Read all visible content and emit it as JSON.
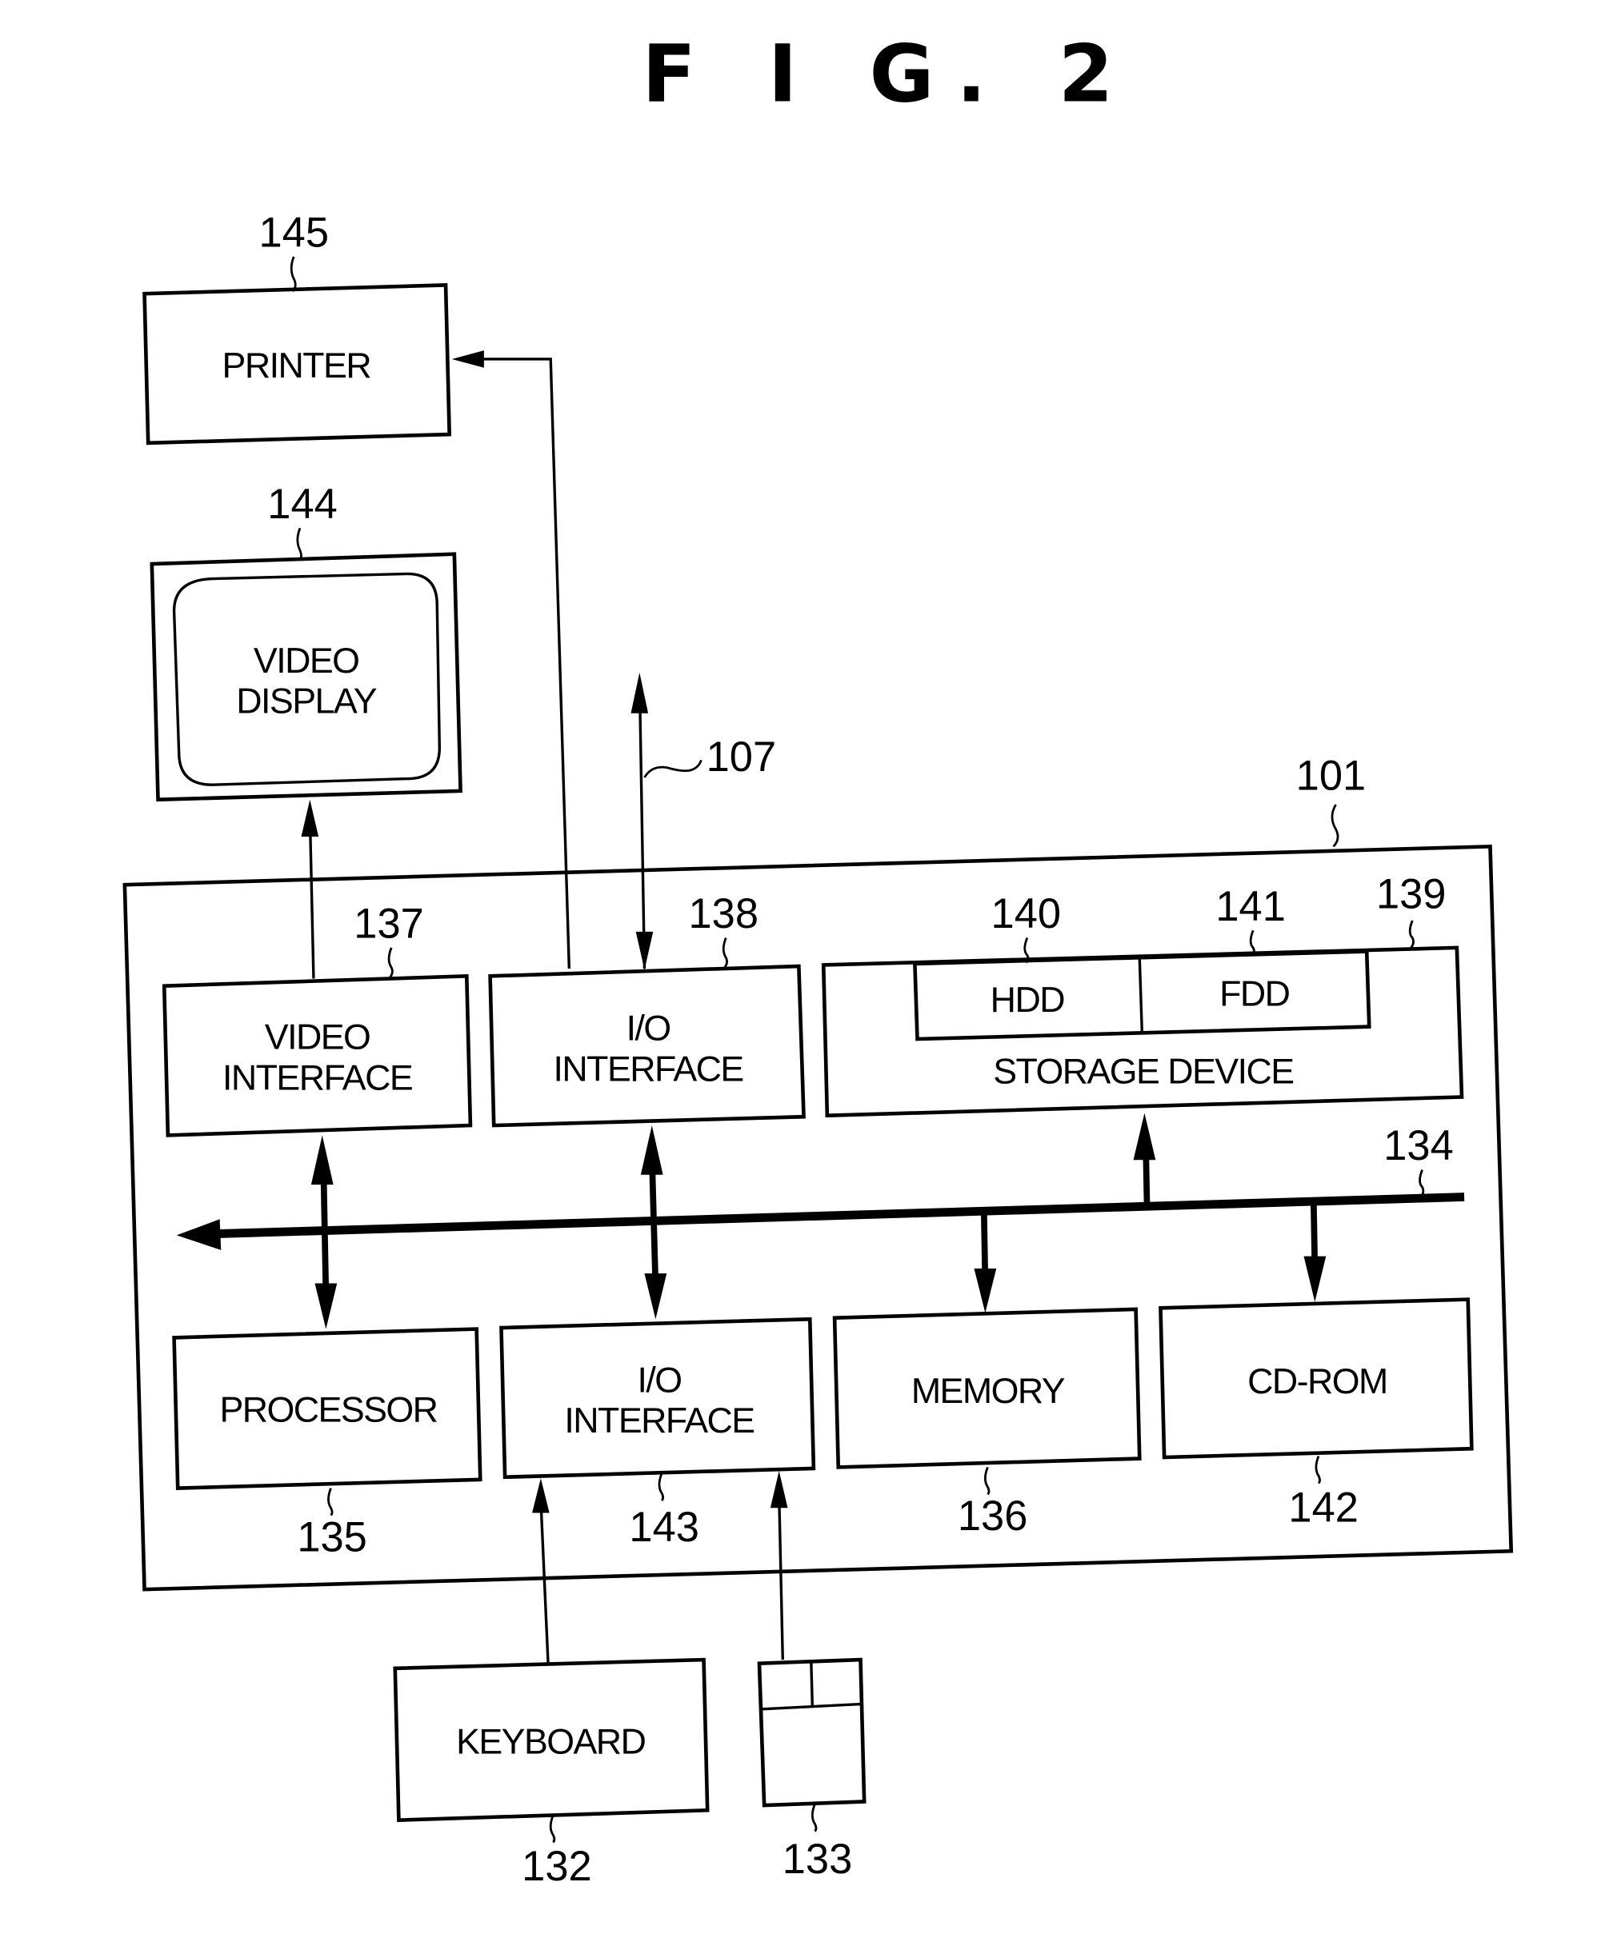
{
  "figure": {
    "title": "F I G. 2"
  },
  "blocks": {
    "printer": {
      "ref": "145",
      "lines": [
        "PRINTER"
      ]
    },
    "video_display": {
      "ref": "144",
      "lines": [
        "VIDEO",
        "DISPLAY"
      ]
    },
    "network": {
      "ref": "107"
    },
    "computer": {
      "ref": "101"
    },
    "video_interface": {
      "ref": "137",
      "lines": [
        "VIDEO",
        "INTERFACE"
      ]
    },
    "io_interface_top": {
      "ref": "138",
      "lines": [
        "I/O",
        "INTERFACE"
      ]
    },
    "storage_device": {
      "ref": "139",
      "lines": [
        "STORAGE DEVICE"
      ]
    },
    "hdd": {
      "ref": "140",
      "lines": [
        "HDD"
      ]
    },
    "fdd": {
      "ref": "141",
      "lines": [
        "FDD"
      ]
    },
    "bus": {
      "ref": "134"
    },
    "processor": {
      "ref": "135",
      "lines": [
        "PROCESSOR"
      ]
    },
    "io_interface_bottom": {
      "ref": "143",
      "lines": [
        "I/O",
        "INTERFACE"
      ]
    },
    "memory": {
      "ref": "136",
      "lines": [
        "MEMORY"
      ]
    },
    "cdrom": {
      "ref": "142",
      "lines": [
        "CD-ROM"
      ]
    },
    "keyboard": {
      "ref": "132",
      "lines": [
        "KEYBOARD"
      ]
    },
    "mouse": {
      "ref": "133"
    }
  },
  "connections": [
    {
      "from": "io_interface_top",
      "to": "printer",
      "type": "unidirectional"
    },
    {
      "from": "video_interface",
      "to": "video_display",
      "type": "unidirectional"
    },
    {
      "from": "io_interface_top",
      "to": "network",
      "type": "bidirectional"
    },
    {
      "from": "bus",
      "to": "video_interface",
      "type": "bidirectional"
    },
    {
      "from": "bus",
      "to": "io_interface_top",
      "type": "bidirectional"
    },
    {
      "from": "bus",
      "to": "storage_device",
      "type": "unidirectional"
    },
    {
      "from": "bus",
      "to": "processor",
      "type": "bidirectional"
    },
    {
      "from": "bus",
      "to": "io_interface_bottom",
      "type": "bidirectional"
    },
    {
      "from": "bus",
      "to": "memory",
      "type": "unidirectional"
    },
    {
      "from": "bus",
      "to": "cdrom",
      "type": "unidirectional"
    },
    {
      "from": "keyboard",
      "to": "io_interface_bottom",
      "type": "unidirectional"
    },
    {
      "from": "mouse",
      "to": "io_interface_bottom",
      "type": "unidirectional"
    }
  ]
}
